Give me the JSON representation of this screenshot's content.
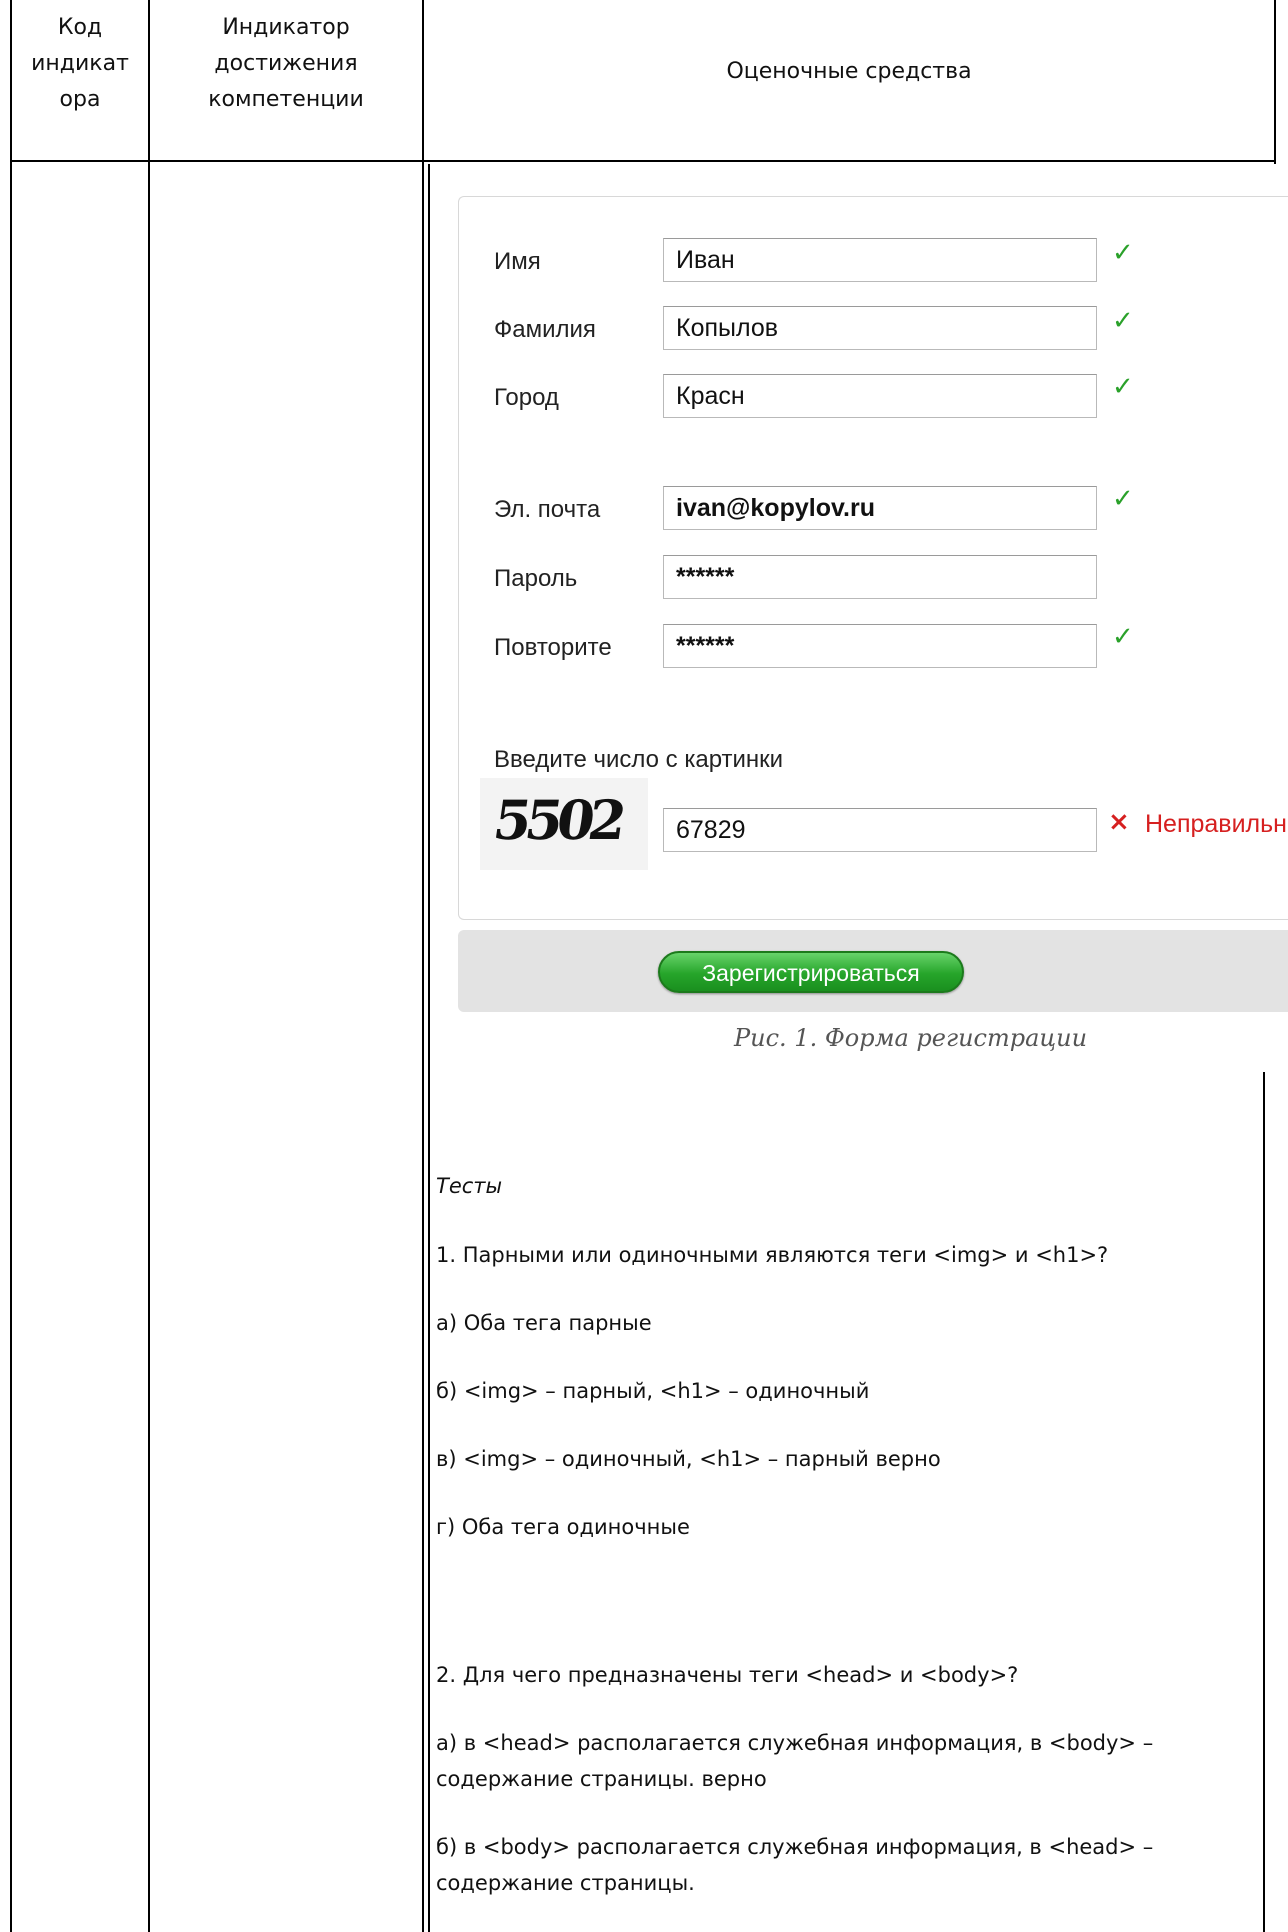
{
  "header": {
    "col1": "Код индикатора",
    "col1_lines": [
      "Код",
      "индикат",
      "ора"
    ],
    "col2_lines": [
      "Индикатор",
      "достижения",
      "компетенции"
    ],
    "col3": "Оценочные средства"
  },
  "form": {
    "fields": [
      {
        "label": "Имя",
        "value": "Иван",
        "valid": true
      },
      {
        "label": "Фамилия",
        "value": "Копылов",
        "valid": true
      },
      {
        "label": "Город",
        "value": "Красн",
        "valid": true
      },
      {
        "label": "Эл. почта",
        "value": "ivan@kopylov.ru",
        "valid": true
      },
      {
        "label": "Пароль",
        "value": "******",
        "valid": false
      },
      {
        "label": "Повторите",
        "value": "******",
        "valid": true
      }
    ],
    "captcha_prompt": "Введите число с картинки",
    "captcha_image_text": "5502",
    "captcha_value": "67829",
    "error_text": "Неправильн",
    "check_mark": "✓",
    "error_mark": "×",
    "submit_label": "Зарегистрироваться",
    "caption": "Рис. 1. Форма регистрации",
    "colors": {
      "valid": "#2aa12a",
      "error": "#d62020",
      "button": "#26a52a"
    }
  },
  "tests": {
    "heading": "Тесты",
    "q1": {
      "question": "1. Парными или одиночными являются теги <img> и <h1>?",
      "options": [
        "а) Оба тега парные",
        "б) <img> – парный, <h1> – одиночный",
        "в) <img> – одиночный, <h1> – парный верно",
        "г) Оба тега одиночные"
      ]
    },
    "q2": {
      "question": "2. Для чего предназначены теги <head> и <body>?",
      "options": [
        " а) в <head> располагается служебная информация, в <body> – содержание страницы. верно",
        " б) в <body> располагается служебная информация, в <head> – содержание страницы."
      ]
    }
  }
}
